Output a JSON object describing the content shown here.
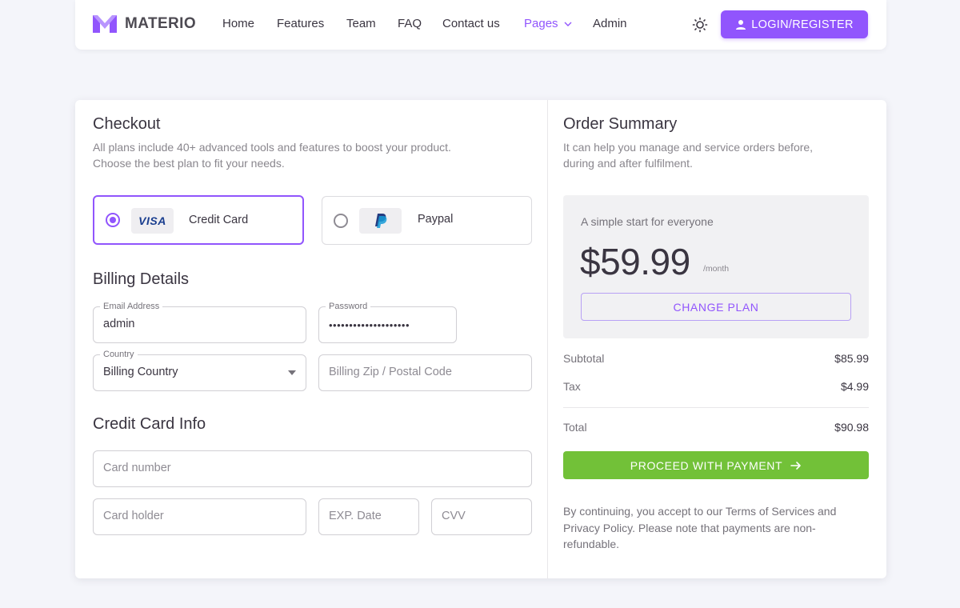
{
  "brand": {
    "name": "MATERIO"
  },
  "nav": {
    "links": [
      "Home",
      "Features",
      "Team",
      "FAQ",
      "Contact us",
      "Pages",
      "Admin"
    ],
    "active": "Pages",
    "login_label": "LOGIN/REGISTER"
  },
  "icons": {
    "logo": "materio-logo-icon",
    "theme": "sun-icon",
    "user": "user-icon",
    "dropdown": "chevron-down-icon",
    "paypal": "paypal-icon",
    "arrow": "arrow-right-icon"
  },
  "colors": {
    "primary": "#9155fd",
    "success": "#72c138",
    "text": "#3a3541"
  },
  "checkout": {
    "title": "Checkout",
    "subtitle_line1": "All plans include 40+ advanced tools and features to boost your product.",
    "subtitle_line2": "Choose the best plan to fit your needs.",
    "payment_options": [
      {
        "brand": "VISA",
        "label": "Credit Card",
        "selected": true
      },
      {
        "brand": "PayPal",
        "label": "Paypal",
        "selected": false
      }
    ]
  },
  "billing": {
    "title": "Billing Details",
    "email": {
      "legend": "Email Address",
      "value": "admin"
    },
    "password": {
      "legend": "Password",
      "value": "••••••••••••••••••••"
    },
    "country": {
      "legend": "Country",
      "value": "Billing Country"
    },
    "zip": {
      "placeholder": "Billing Zip / Postal Code"
    }
  },
  "card_info": {
    "title": "Credit Card Info",
    "card_number": "Card number",
    "card_holder": "Card holder",
    "exp_date": "EXP. Date",
    "cvv": "CVV"
  },
  "summary": {
    "title": "Order Summary",
    "subtitle_line1": "It can help you manage and service orders before,",
    "subtitle_line2": "during and after fulfilment.",
    "plan_tagline": "A simple start for everyone",
    "price": "$59.99",
    "period": "/month",
    "change_plan": "CHANGE PLAN",
    "subtotal_label": "Subtotal",
    "subtotal": "$85.99",
    "tax_label": "Tax",
    "tax": "$4.99",
    "total_label": "Total",
    "total": "$90.98",
    "proceed": "PROCEED WITH PAYMENT",
    "terms": "By continuing, you accept to our Terms of Services and Privacy Policy. Please note that payments are non-refundable."
  }
}
